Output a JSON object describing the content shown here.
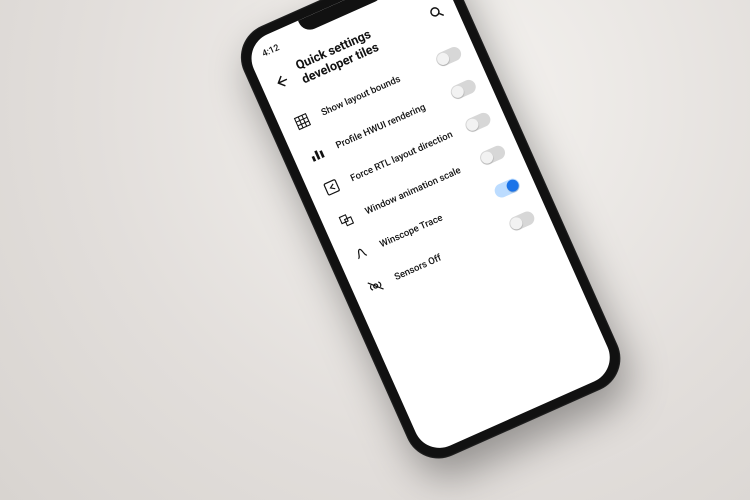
{
  "status": {
    "time": "4:12"
  },
  "header": {
    "title": "Quick settings developer tiles"
  },
  "rows": [
    {
      "label": "Show layout bounds",
      "on": false
    },
    {
      "label": "Profile HWUI rendering",
      "on": false
    },
    {
      "label": "Force RTL layout direction",
      "on": false
    },
    {
      "label": "Window animation scale",
      "on": false
    },
    {
      "label": "Winscope Trace",
      "on": true
    },
    {
      "label": "Sensors Off",
      "on": false
    }
  ]
}
